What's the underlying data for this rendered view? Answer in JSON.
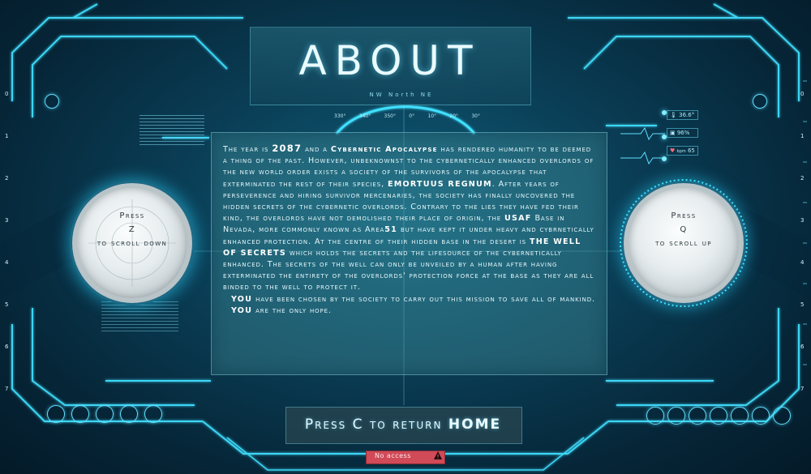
{
  "title": "ABOUT",
  "compass": {
    "labels": [
      "NW",
      "North",
      "NE"
    ],
    "degrees": [
      "330°",
      "340°",
      "350°",
      "0°",
      "10°",
      "20°",
      "30°"
    ]
  },
  "story_parts": {
    "p1": "The year is ",
    "year": "2087",
    "p2": " and a ",
    "apocalypse": "Cybernetic Apocalypse",
    "p3": " has rendered humanity to be deemed a thing of the past. However, unbeknownst to the cybernetically enhanced overlords of the new world order exists a society of the survivors of the apocalypse that exterminated the rest of their species, ",
    "society": "EMORTUUS REGNUM",
    "p4": ". After years of perseverence and hiring survivor mercenaries, the society has finally uncovered the hidden secrets of the cybernetic overlords. Contrary to the lies they have fed their kind, the overlords have not demolished their place of origin, the ",
    "usaf": "USAF",
    "p5": " Base in Nevada, more commonly known as Area",
    "area": "51",
    "p6": " but have kept it under heavy and cybrnetically enhanced protection. At the centre of their hidden base in the desert is ",
    "well": "THE WELL OF SECRETS",
    "p7": " which holds the secrets and the lifesource of the cybernetically enhanced. The secrets of the well can only be unveiled by a human after having exterminated the entirety of the overlords' protection force at the base as they are all binded to the well to protect it.",
    "you1": "YOU",
    "p8": " have been chosen by the society to carry out this mission to save all of mankind. ",
    "you2": "YOU",
    "p9": " are the only hope."
  },
  "left_dial": {
    "line1": "Press",
    "line2": "Z",
    "line3": "to scroll down"
  },
  "right_dial": {
    "line1": "Press",
    "line2": "Q",
    "line3": "to scroll up"
  },
  "return": {
    "prefix": "Press C to return ",
    "home": "HOME"
  },
  "access": {
    "label": "No access",
    "icon": "warning-icon"
  },
  "stats": [
    "36.6°",
    "96%",
    "65"
  ],
  "stat_units": [
    "",
    "",
    "bpm"
  ],
  "axis_numbers": [
    "0",
    "1",
    "2",
    "3",
    "4",
    "5",
    "6",
    "7"
  ],
  "colors": {
    "accent": "#3fe0ff",
    "panel": "#4a9aa3",
    "access_bar": "#d04a58"
  }
}
